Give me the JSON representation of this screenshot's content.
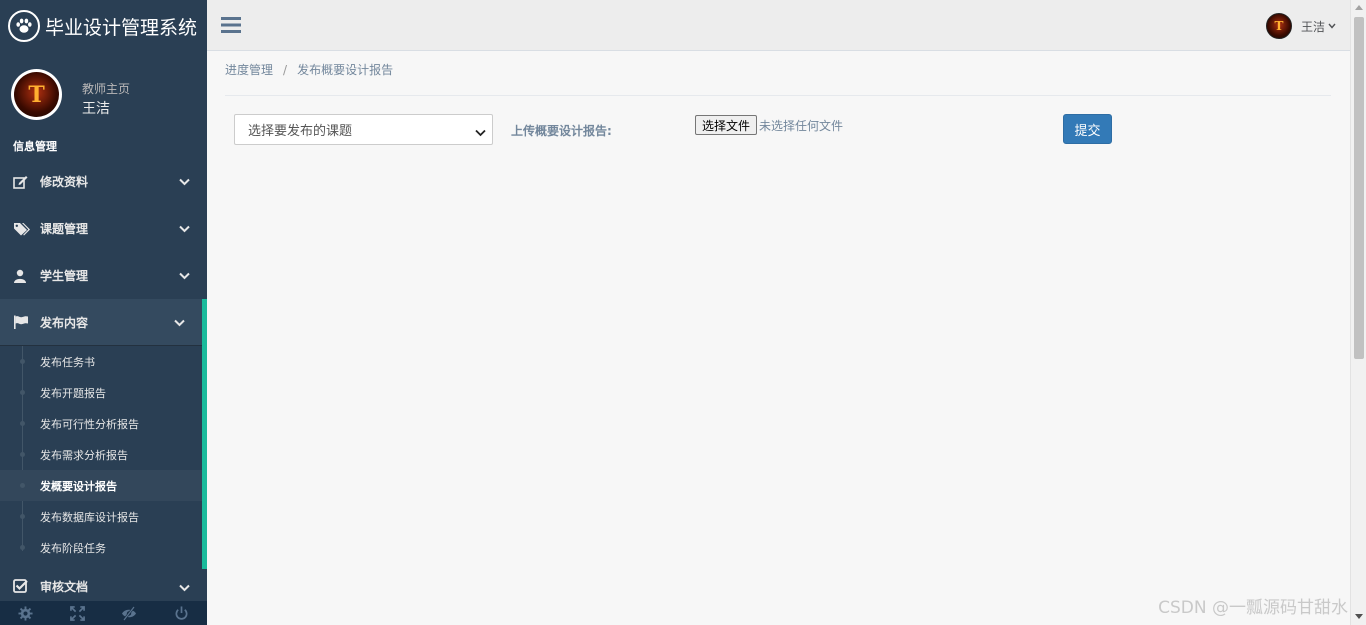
{
  "app": {
    "title": "毕业设计管理系统"
  },
  "profile": {
    "role": "教师主页",
    "name": "王洁",
    "avatar_letter": "T"
  },
  "sidebar": {
    "section_title": "信息管理",
    "items": [
      {
        "label": "修改资料",
        "icon": "edit-icon"
      },
      {
        "label": "课题管理",
        "icon": "tags-icon"
      },
      {
        "label": "学生管理",
        "icon": "user-icon"
      },
      {
        "label": "发布内容",
        "icon": "flag-icon"
      },
      {
        "label": "审核文档",
        "icon": "check-square-icon"
      }
    ],
    "sub_items": [
      {
        "label": "发布任务书"
      },
      {
        "label": "发布开题报告"
      },
      {
        "label": "发布可行性分析报告"
      },
      {
        "label": "发布需求分析报告"
      },
      {
        "label": "发概要设计报告"
      },
      {
        "label": "发布数据库设计报告"
      },
      {
        "label": "发布阶段任务"
      }
    ],
    "footer_icons": [
      "gear-icon",
      "fullscreen-icon",
      "eye-slash-icon",
      "power-icon"
    ]
  },
  "topnav": {
    "user_name": "王洁"
  },
  "breadcrumb": {
    "parent": "进度管理",
    "separator": "/",
    "current": "发布概要设计报告"
  },
  "form": {
    "select_value": "选择要发布的课题",
    "upload_label": "上传概要设计报告:",
    "file_button": "选择文件",
    "file_status": "未选择任何文件",
    "submit_label": "提交"
  },
  "watermark": "CSDN @一瓢源码甘甜水",
  "colors": {
    "sidebar_bg": "#2a3f54",
    "active_accent": "#1abb9c",
    "primary_button": "#337ab7"
  }
}
